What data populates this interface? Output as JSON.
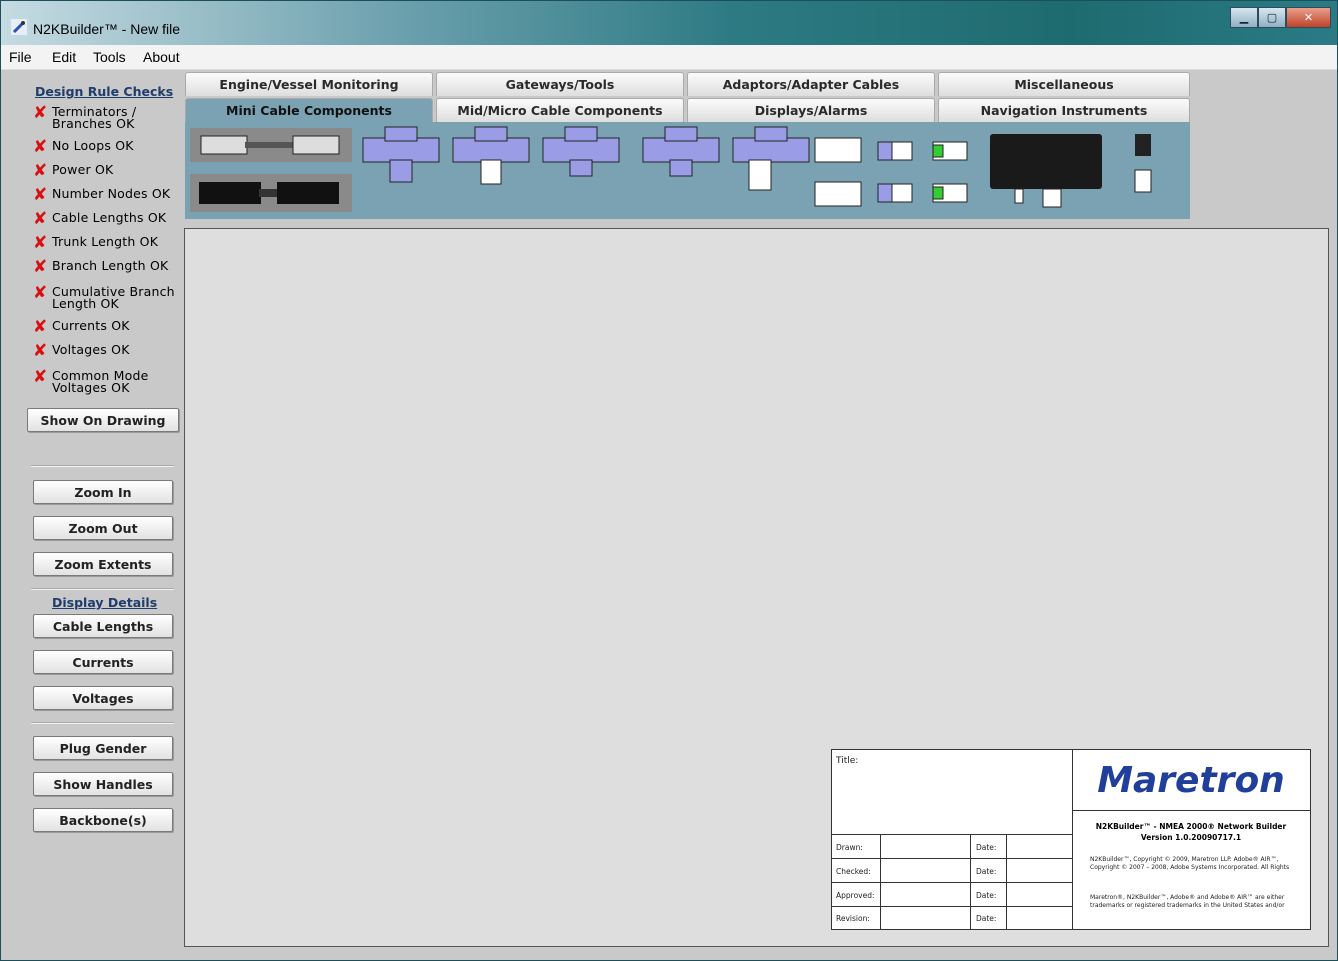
{
  "window": {
    "title": "N2KBuilder™ - New file"
  },
  "menu": [
    "File",
    "Edit",
    "Tools",
    "About"
  ],
  "tabs_row1": [
    "Engine/Vessel Monitoring",
    "Gateways/Tools",
    "Adaptors/Adapter Cables",
    "Miscellaneous"
  ],
  "tabs_row2": [
    "Mini Cable Components",
    "Mid/Micro Cable Components",
    "Displays/Alarms",
    "Navigation Instruments"
  ],
  "active_tab": "Mini Cable Components",
  "design_rules": {
    "title": "Design Rule Checks",
    "checks": [
      {
        "label": "Terminators /\nBranches OK"
      },
      {
        "label": "No Loops OK"
      },
      {
        "label": "Power OK"
      },
      {
        "label": "Number Nodes OK"
      },
      {
        "label": "Cable Lengths OK"
      },
      {
        "label": "Trunk Length OK"
      },
      {
        "label": "Branch Length OK"
      },
      {
        "label": "Cumulative Branch\nLength OK"
      },
      {
        "label": "Currents OK"
      },
      {
        "label": "Voltages OK"
      },
      {
        "label": "Common Mode\nVoltages OK"
      }
    ],
    "show_on_drawing": "Show On Drawing"
  },
  "zoom": {
    "in": "Zoom In",
    "out": "Zoom Out",
    "extents": "Zoom Extents"
  },
  "display_details": {
    "title": "Display Details",
    "cable_lengths": "Cable Lengths",
    "currents": "Currents",
    "voltages": "Voltages"
  },
  "tools": {
    "plug_gender": "Plug Gender",
    "show_handles": "Show Handles",
    "backbones": "Backbone(s)"
  },
  "title_block": {
    "title_label": "Title:",
    "logo": "Maretron",
    "rows": [
      "Drawn:",
      "Checked:",
      "Approved:",
      "Revision:"
    ],
    "date_label": "Date:",
    "product": "N2KBuilder™ - NMEA 2000® Network Builder",
    "version": "Version 1.0.20090717.1",
    "copyright": "N2KBuilder™, Copyright © 2009, Maretron LLP. Adobe® AIR™, Copyright © 2007 – 2008, Adobe Systems Incorporated. All Rights",
    "trademarks": "Maretron®, N2KBuilder™, Adobe® and Adobe® AIR™ are either trademarks or registered trademarks in the United States and/or"
  },
  "colors": {
    "palette_bg": "#7aa2b3",
    "tee": "#9a9de6",
    "error_x": "#d81010",
    "logo": "#1f3f9a"
  }
}
